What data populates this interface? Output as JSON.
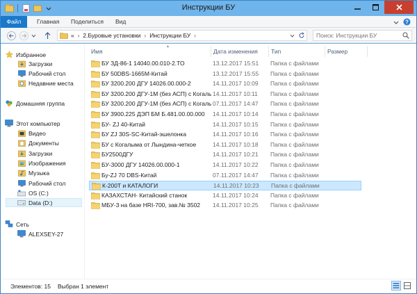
{
  "window": {
    "title": "Инструкции БУ"
  },
  "ribbon": {
    "tabs": [
      "Файл",
      "Главная",
      "Поделиться",
      "Вид"
    ]
  },
  "address": {
    "prefix": "«",
    "crumbs": [
      "2.Буровые установки",
      "Инструкции БУ"
    ]
  },
  "search": {
    "placeholder": "Поиск: Инструкции БУ"
  },
  "nav": {
    "favorites": "Избранное",
    "fav_items": [
      "Загрузки",
      "Рабочий стол",
      "Недавние места"
    ],
    "homegroup": "Домашняя группа",
    "computer": "Этот компьютер",
    "pc_items": [
      "Видео",
      "Документы",
      "Загрузки",
      "Изображения",
      "Музыка",
      "Рабочий стол",
      "OS (C:)",
      "Data (D:)"
    ],
    "network": "Сеть",
    "net_items": [
      "ALEXSEY-27"
    ]
  },
  "columns": [
    "Имя",
    "Дата изменения",
    "Тип",
    "Размер"
  ],
  "files": [
    {
      "name": "БУ ЗД-86-1 14040.00.010-2.ТО",
      "date": "13.12.2017 15:51",
      "type": "Папка с файлами"
    },
    {
      "name": "БУ 50DBS-1665M-Китай",
      "date": "13.12.2017 15:55",
      "type": "Папка с файлами"
    },
    {
      "name": "БУ 3200.200 ДГУ   14026.00.000-2",
      "date": "14.11.2017 10:09",
      "type": "Папка с файлами"
    },
    {
      "name": "БУ 3200.200 ДГУ-1М (без АСП) с Когаль...",
      "date": "14.11.2017 10:11",
      "type": "Папка с файлами"
    },
    {
      "name": "БУ 3200.200 ДГУ-1М (без АСП) с Когаль...",
      "date": "07.11.2017 14:47",
      "type": "Папка с файлами"
    },
    {
      "name": "БУ 3900.225 ДЭП БМ  Б.481.00.00.000",
      "date": "14.11.2017 10:14",
      "type": "Папка с файлами"
    },
    {
      "name": "БУ- ZJ 40-Китай",
      "date": "14.11.2017 10:15",
      "type": "Папка с файлами"
    },
    {
      "name": "БУ ZJ 30S-SC-Китай-эшелонка",
      "date": "14.11.2017 10:16",
      "type": "Папка с файлами"
    },
    {
      "name": "БУ с Когалыма от Лындина-четкое",
      "date": "14.11.2017 10:18",
      "type": "Папка с файлами"
    },
    {
      "name": "БУ2500ДГУ",
      "date": "14.11.2017 10:21",
      "type": "Папка с файлами"
    },
    {
      "name": "БУ-3000 ДГУ  14026.00.000-1",
      "date": "14.11.2017 10:22",
      "type": "Папка с файлами"
    },
    {
      "name": "Бу-ZJ 70 DBS-Китай",
      "date": "07.11.2017 14:47",
      "type": "Папка с файлами"
    },
    {
      "name": "К-200Т и КАТАЛОГИ",
      "date": "14.11.2017 10:23",
      "type": "Папка с файлами"
    },
    {
      "name": "КАЗАХСТАН- Китайский станок",
      "date": "14.11.2017 10:24",
      "type": "Папка с файлами"
    },
    {
      "name": "МБУ-3 на базе HRI-700, зав.№ 3502",
      "date": "14.11.2017 10:25",
      "type": "Папка с файлами"
    }
  ],
  "selected_index": 12,
  "status": {
    "items_count": "Элементов: 15",
    "selected": "Выбран 1 элемент"
  },
  "colors": {
    "accent": "#1979ca",
    "selection": "#cce8ff",
    "folder": "#e8b94c",
    "close": "#c7402f"
  }
}
